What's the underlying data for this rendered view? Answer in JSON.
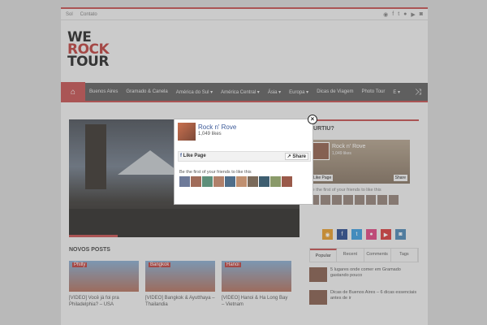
{
  "topbar": {
    "link1": "Sol",
    "link2": "Contato"
  },
  "logo": {
    "line1": "WE",
    "line2": "ROCK",
    "line3": "TOUR"
  },
  "nav": {
    "items": [
      "Buenos Aires",
      "Gramado & Canela",
      "América do Sul ▾",
      "América Central ▾",
      "Ásia ▾",
      "Europa ▾",
      "Dicas de Viagem",
      "Photo Tour",
      "E ▾"
    ]
  },
  "posts": {
    "section_title": "NOVOS POSTS",
    "items": [
      {
        "tag": "Philly",
        "title": "[VIDEO] Você já foi pra Philadelphia? – USA"
      },
      {
        "tag": "Bangkok",
        "title": "[VIDEO] Bangkok & Ayutthaya – Thailandia"
      },
      {
        "tag": "Hanoi",
        "title": "[VIDEO] Hanoi & Ha Long Bay – Vietnam"
      }
    ]
  },
  "sidebar": {
    "heading": "CURTIU?",
    "fb_name": "Rock n' Rove",
    "fb_likes": "1,049 likes",
    "like_page": "Like Page",
    "share": "Share",
    "first_text": "Be the first of your friends to like this",
    "tabs": [
      "Popular",
      "Recent",
      "Comments",
      "Tags"
    ],
    "list": [
      "5 lugares onde comer em Gramado gastando pouco",
      "Dicas de Buenos Aires – 6 dicas essenciais antes de ir"
    ]
  },
  "popup": {
    "name": "Rock n' Rove",
    "likes": "1,049 likes",
    "like_page": "Like Page",
    "share": "Share",
    "first_text": "Be the first of your friends to like this",
    "close": "×"
  },
  "colors": {
    "accent": "#c75f5f",
    "nav_bg": "#6c6c6c",
    "fb_blue": "#3b5998"
  }
}
